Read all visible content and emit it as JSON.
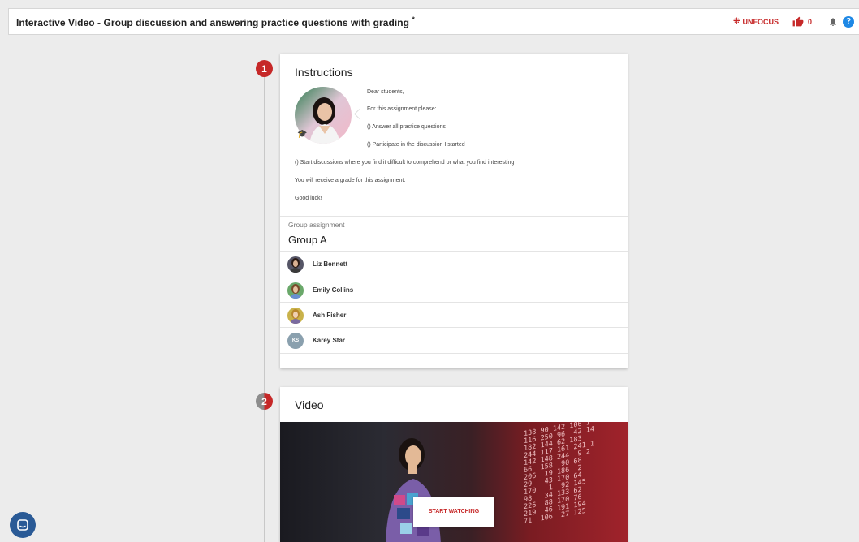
{
  "header": {
    "title": "Interactive Video - Group discussion and answering practice questions with grading",
    "title_suffix": "*",
    "unfocus_label": "UNFOCUS",
    "likes_count": "0",
    "help_label": "?"
  },
  "steps": {
    "step1": "1",
    "step2": "2"
  },
  "instructions": {
    "title": "Instructions",
    "lines": [
      "Dear students,",
      "For this assignment please:",
      "() Answer all practice questions",
      "() Participate in the discussion I started",
      "() Start discussions where you find it difficult to comprehend or what you find interesting",
      "You will receive a grade for this assignment.",
      "Good luck!"
    ]
  },
  "group": {
    "label": "Group assignment",
    "name": "Group A",
    "members": [
      {
        "name": "Liz Bennett"
      },
      {
        "name": "Emily Collins"
      },
      {
        "name": "Ash Fisher"
      },
      {
        "name": "Karey Star",
        "initials": "KS"
      }
    ]
  },
  "video": {
    "title": "Video",
    "start_label": "START WATCHING"
  },
  "colors": {
    "accent": "#c62828",
    "help": "#1e88e5",
    "chat": "#2a5a96"
  }
}
